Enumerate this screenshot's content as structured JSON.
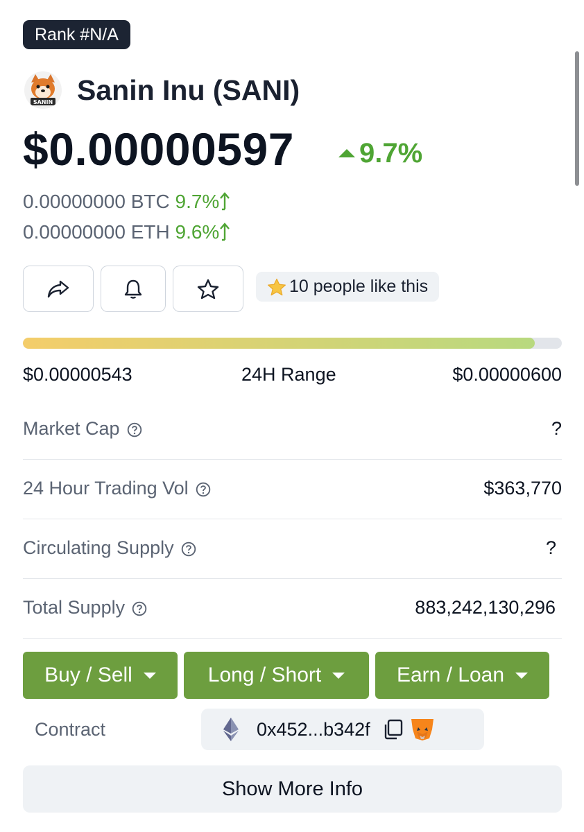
{
  "rank": "Rank #N/A",
  "coin": {
    "name": "Sanin Inu (SANI)",
    "logo_text": "SANIN"
  },
  "price": {
    "usd": "$0.00000597",
    "change_24h": "9.7%"
  },
  "conversions": [
    {
      "value": "0.00000000 BTC",
      "change": "9.7%"
    },
    {
      "value": "0.00000000 ETH",
      "change": "9.6%"
    }
  ],
  "actions": {
    "share_icon": "share-icon",
    "alert_icon": "bell-icon",
    "watchlist_icon": "star-icon",
    "likes_label": "10 people like this"
  },
  "range_24h": {
    "low": "$0.00000543",
    "label": "24H Range",
    "high": "$0.00000600",
    "position_fraction": 0.95
  },
  "stats": [
    {
      "label": "Market Cap",
      "value": "?"
    },
    {
      "label": "24 Hour Trading Vol",
      "value": "$363,770"
    },
    {
      "label": "Circulating Supply",
      "value": "?"
    },
    {
      "label": "Total Supply",
      "value": "883,242,130,296"
    }
  ],
  "trade_buttons": [
    {
      "label": "Buy / Sell"
    },
    {
      "label": "Long / Short"
    },
    {
      "label": "Earn / Loan"
    }
  ],
  "contract": {
    "label": "Contract",
    "address": "0x452...b342f"
  },
  "more_info": "Show More Info",
  "colors": {
    "positive": "#4fa534",
    "button_green": "#6d9e3f",
    "dark": "#1c2433"
  }
}
